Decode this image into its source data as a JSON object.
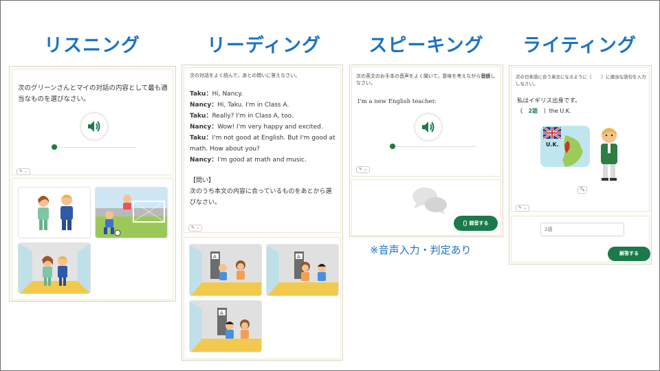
{
  "titles": {
    "listening": "リスニング",
    "reading": "リーディング",
    "speaking": "スピーキング",
    "writing": "ライティング"
  },
  "listening": {
    "instruction": "次のグリーンさんとマイの対話の内容として最も適当なものを選びなさい。",
    "dropdown": "✎ ⌄"
  },
  "reading": {
    "instruction": "次の対話をよく読んで，あとの問いに答えなさい。",
    "dialog": [
      {
        "speaker": "Taku：",
        "text": "Hi, Nancy."
      },
      {
        "speaker": "Nancy：",
        "text": "Hi, Taku. I'm in Class A."
      },
      {
        "speaker": "Taku：",
        "text": "Really? I'm in Class A, too."
      },
      {
        "speaker": "Nancy：",
        "text": "Wow! I'm very happy and excited."
      },
      {
        "speaker": "Taku：",
        "text": "I'm not good at English. But I'm good at"
      },
      {
        "speaker": "",
        "text": "math. How about you?"
      },
      {
        "speaker": "Nancy：",
        "text": "I'm good at math and music."
      }
    ],
    "question_label": "【問い】",
    "question_text": "次のうち本文の内容に合っているものをあとから選びなさい。",
    "dropdown": "✎ ⌄"
  },
  "speaking": {
    "instruction_a": "次の英文のお手本の音声をよく聞いて，意味を考えながら",
    "instruction_bold": "音読",
    "instruction_b": "しなさい。",
    "sentence": "I'm a new English teacher.",
    "dropdown": "✎ ⌄",
    "record_button": "録音する",
    "note": "※音声入力・判定あり"
  },
  "writing": {
    "instruction_a": "次の日本語に合う英文になるように（",
    "instruction_b": "）に適当な語句を入力しなさい。",
    "jp_sentence": "私はイギリス出身です。",
    "blank_open": "（",
    "blank_value": "2語",
    "blank_close": "）the U.K.",
    "map_label": "U.K.",
    "zoom": "🔍",
    "dropdown": "✎ ⌄",
    "input_placeholder": "2語",
    "answer_button": "解答する"
  },
  "colors": {
    "title_blue": "#1a73c6",
    "accent_green": "#1b7a4a"
  }
}
